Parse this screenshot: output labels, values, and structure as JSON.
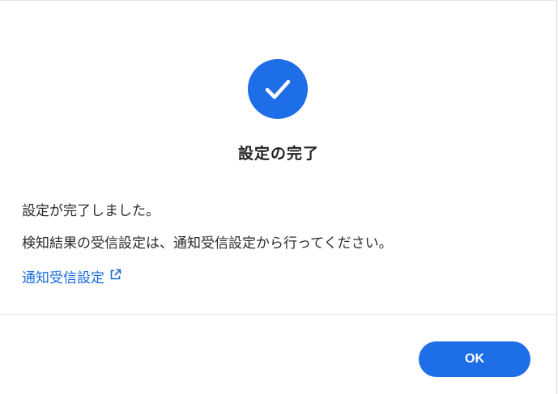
{
  "dialog": {
    "icon": "check-circle-icon",
    "title": "設定の完了",
    "message_line1": "設定が完了しました。",
    "message_line2": "検知結果の受信設定は、通知受信設定から行ってください。",
    "link_label": "通知受信設定",
    "link_icon": "external-link-icon",
    "ok_label": "OK"
  },
  "colors": {
    "accent": "#1e6ee8",
    "link": "#1a6bdc",
    "text": "#2b2b2b",
    "divider": "#e3e3e3"
  }
}
